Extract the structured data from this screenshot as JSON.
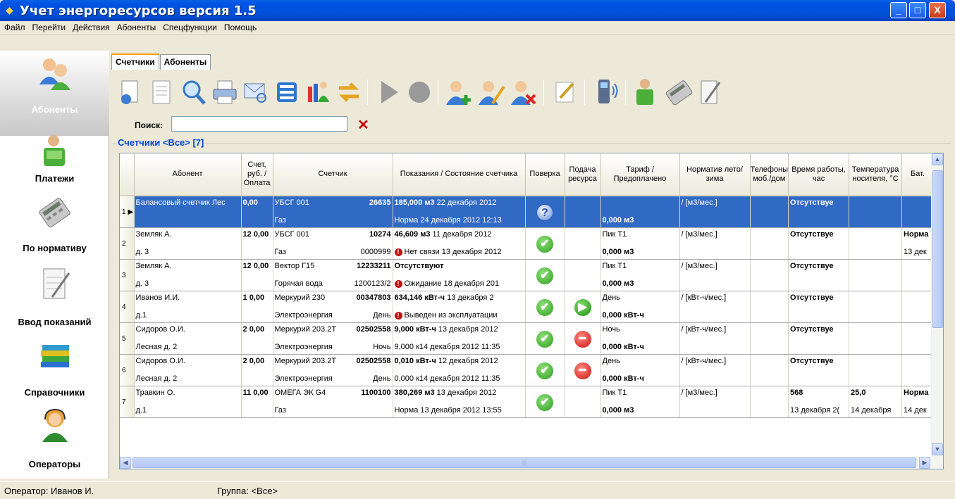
{
  "window": {
    "title": "Учет энергоресурсов версия 1.5",
    "min": "_",
    "max": "□",
    "close": "X"
  },
  "menu": [
    "Файл",
    "Перейти",
    "Действия",
    "Абоненты",
    "Спецфункции",
    "Помощь"
  ],
  "sidebar": [
    {
      "label": "Абоненты",
      "icon": "subscribers-icon"
    },
    {
      "label": "Платежи",
      "icon": "payments-icon"
    },
    {
      "label": "По нормативу",
      "icon": "calculator-icon"
    },
    {
      "label": "Ввод показаний",
      "icon": "notepad-icon"
    },
    {
      "label": "Справочники",
      "icon": "books-icon"
    },
    {
      "label": "Операторы",
      "icon": "operator-icon"
    }
  ],
  "tabs": [
    "Счетчики",
    "Абоненты"
  ],
  "search": {
    "label": "Поиск:",
    "value": ""
  },
  "group_title": "Счетчики <Все> [7]",
  "columns": [
    "Абонент",
    "Счет, руб. / Оплата",
    "Счетчик",
    "Показания / Состояние счетчика",
    "Поверка",
    "Подача ресурса",
    "Тариф / Предоплачено",
    "Норматив лето/зима",
    "Телефоны моб./дом",
    "Время работы, час",
    "Температура носителя, °C",
    "Бат."
  ],
  "rows": [
    {
      "n": "1",
      "abon": "Балансовый счетчик Лес",
      "abon2": "",
      "sum": "",
      "pay": "0,00",
      "meter": "УБСГ 001",
      "mnum": "26635",
      "mtype": "Газ",
      "mcode": "",
      "read": "185,000 м3",
      "rdate": "22 декабря 2012",
      "state": "Норма 24 декабря 2012 12:13",
      "swarn": false,
      "check": "q",
      "supply": "",
      "tariff": "",
      "prepay": "0,000 м3",
      "norm": "/ [м3/мес.]",
      "phone": "",
      "time": "Отсутствуе",
      "time2": "",
      "temp": "",
      "temp2": "",
      "bat": "",
      "bat2": ""
    },
    {
      "n": "2",
      "abon": "Земляк А.",
      "abon2": "д. 3",
      "sum": "12",
      "pay": "0,00",
      "meter": "УБСГ 001",
      "mnum": "10274",
      "mtype": "Газ",
      "mcode": "0000999",
      "read": "46,609 м3",
      "rdate": "11 декабря 2012",
      "state": "Нет связи 13 декабря 2012",
      "swarn": true,
      "check": "ok",
      "supply": "",
      "tariff": "Пик Т1",
      "prepay": "0,000 м3",
      "norm": "/ [м3/мес.]",
      "phone": "",
      "time": "Отсутствуе",
      "time2": "",
      "temp": "",
      "temp2": "",
      "bat": "Норма",
      "bat2": "13 дек"
    },
    {
      "n": "3",
      "abon": "Земляк А.",
      "abon2": "д. 3",
      "sum": "12",
      "pay": "0,00",
      "meter": "Вектор Г15",
      "mnum": "12233211",
      "mtype": "Горячая вода",
      "mcode": "1200123/2",
      "read": "Отсутствуют",
      "rdate": "",
      "state": "Ожидание 18 декабря 201",
      "swarn": true,
      "check": "ok",
      "supply": "",
      "tariff": "Пик Т1",
      "prepay": "0,000 м3",
      "norm": "/ [м3/мес.]",
      "phone": "",
      "time": "Отсутствуе",
      "time2": "",
      "temp": "",
      "temp2": "",
      "bat": "",
      "bat2": ""
    },
    {
      "n": "4",
      "abon": "Иванов И.И.",
      "abon2": "д.1",
      "sum": "1",
      "pay": "0,00",
      "meter": "Меркурий 230",
      "mnum": "00347803",
      "mtype": "Электроэнергия",
      "mcode": "День",
      "read": "634,146 кВт-ч",
      "rdate": "13 декабря 2",
      "state": "Выведен из эксплуатации",
      "swarn": true,
      "check": "ok",
      "supply": "play",
      "tariff": "День",
      "prepay": "0,000 кВт-ч",
      "norm": "/ [кВт-ч/мес.]",
      "phone": "",
      "time": "Отсутствуе",
      "time2": "",
      "temp": "",
      "temp2": "",
      "bat": "",
      "bat2": ""
    },
    {
      "n": "5",
      "abon": "Сидоров О.И.",
      "abon2": "Лесная д. 2",
      "sum": "2",
      "pay": "0,00",
      "meter": "Меркурий 203.2Т",
      "mnum": "02502558",
      "mtype": "Электроэнергия",
      "mcode": "Ночь",
      "read": "9,000 кВт-ч",
      "rdate": "13 декабря 2012",
      "state": "9,000 к14 декабря 2012 11:35",
      "swarn": false,
      "check": "ok",
      "supply": "stop",
      "tariff": "Ночь",
      "prepay": "0,000 кВт-ч",
      "norm": "/ [кВт-ч/мес.]",
      "phone": "",
      "time": "Отсутствуе",
      "time2": "",
      "temp": "",
      "temp2": "",
      "bat": "",
      "bat2": ""
    },
    {
      "n": "6",
      "abon": "Сидоров О.И.",
      "abon2": "Лесная д. 2",
      "sum": "2",
      "pay": "0,00",
      "meter": "Меркурий 203.2Т",
      "mnum": "02502558",
      "mtype": "Электроэнергия",
      "mcode": "День",
      "read": "0,010 кВт-ч",
      "rdate": "12 декабря 2012",
      "state": "0,000 к14 декабря 2012 11:35",
      "swarn": false,
      "check": "ok",
      "supply": "stop",
      "tariff": "День",
      "prepay": "0,000 кВт-ч",
      "norm": "/ [кВт-ч/мес.]",
      "phone": "",
      "time": "Отсутствуе",
      "time2": "",
      "temp": "",
      "temp2": "",
      "bat": "",
      "bat2": ""
    },
    {
      "n": "7",
      "abon": "Травкин О.",
      "abon2": "д.1",
      "sum": "11",
      "pay": "0,00",
      "meter": "ОМЕГА ЭК G4",
      "mnum": "1100100",
      "mtype": "Газ",
      "mcode": "",
      "read": "380,269 м3",
      "rdate": "13 декабря 2012",
      "state": "Норма 13 декабря 2012 13:55",
      "swarn": false,
      "check": "ok",
      "supply": "",
      "tariff": "Пик Т1",
      "prepay": "0,000 м3",
      "norm": "/ [м3/мес.]",
      "phone": "",
      "time": "568",
      "time2": "13 декабря 2(",
      "temp": "25,0",
      "temp2": "14 декабря",
      "bat": "Норма",
      "bat2": "14 дек"
    }
  ],
  "status": {
    "operator": "Оператор: Иванов И.",
    "group": "Группа: <Все>"
  },
  "colors": {
    "title": "#0053e1",
    "selection": "#316ac5",
    "caption": "#0046d5"
  }
}
